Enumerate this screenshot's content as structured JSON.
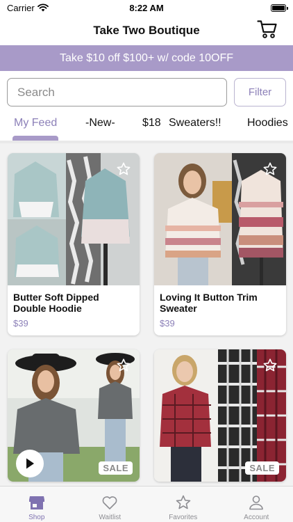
{
  "status": {
    "carrier": "Carrier",
    "time": "8:22 AM",
    "battery_level": 1.0
  },
  "nav": {
    "title": "Take Two Boutique",
    "cart_icon": "cart-icon"
  },
  "promo": {
    "text": "Take $10 off $100+ w/ code 10OFF",
    "background": "#a89ac8"
  },
  "search": {
    "placeholder": "Search",
    "value": "",
    "filter_label": "Filter"
  },
  "tabs": [
    {
      "label": "My Feed",
      "active": true
    },
    {
      "label": "-New-",
      "active": false
    },
    {
      "label": "$18",
      "active": false
    },
    {
      "label": "Sweaters!!",
      "active": false
    },
    {
      "label": "Hoodies",
      "active": false
    }
  ],
  "products": [
    {
      "title": "Butter Soft Dipped Double Hoodie",
      "price": "$39",
      "sale": false,
      "video": false
    },
    {
      "title": "Loving It Button Trim Sweater",
      "price": "$39",
      "sale": false,
      "video": false
    },
    {
      "title": "",
      "price": "",
      "sale": true,
      "sale_label": "SALE",
      "video": true
    },
    {
      "title": "",
      "price": "",
      "sale": true,
      "sale_label": "SALE",
      "video": false
    }
  ],
  "tabbar": [
    {
      "label": "Shop",
      "icon": "store-icon",
      "active": true
    },
    {
      "label": "Waitlist",
      "icon": "heart-icon",
      "active": false
    },
    {
      "label": "Favorites",
      "icon": "star-icon",
      "active": false
    },
    {
      "label": "Account",
      "icon": "person-icon",
      "active": false
    }
  ],
  "colors": {
    "accent": "#8c80b8",
    "banner": "#a89ac8",
    "price": "#8c80b8"
  }
}
